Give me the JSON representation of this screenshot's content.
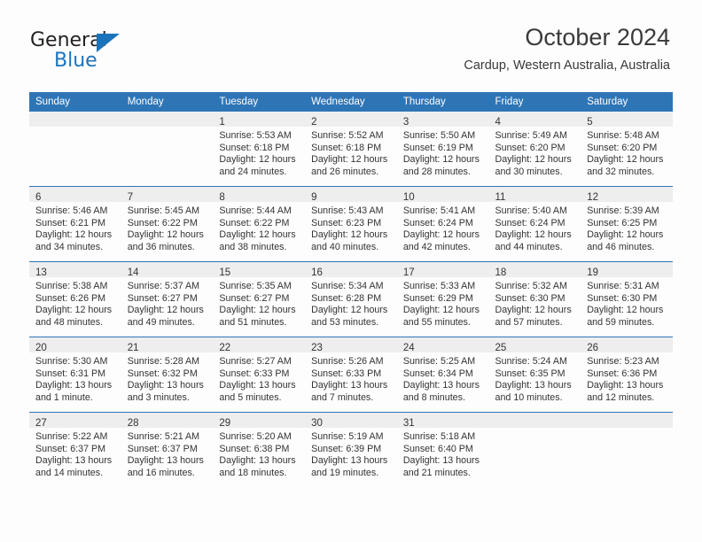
{
  "brand": {
    "name_top": "General",
    "name_bottom": "Blue",
    "accent_color": "#1b74bb"
  },
  "header": {
    "title": "October 2024",
    "subtitle": "Cardup, Western Australia, Australia"
  },
  "theme": {
    "header_bar_color": "#2e75b6",
    "daynum_band_color": "#eeeeee",
    "page_background": "#fdfdfd",
    "text_color": "#333333"
  },
  "weekday_headers": [
    "Sunday",
    "Monday",
    "Tuesday",
    "Wednesday",
    "Thursday",
    "Friday",
    "Saturday"
  ],
  "weeks": [
    [
      {
        "day": "",
        "lines": []
      },
      {
        "day": "",
        "lines": []
      },
      {
        "day": "1",
        "lines": [
          "Sunrise: 5:53 AM",
          "Sunset: 6:18 PM",
          "Daylight: 12 hours",
          "and 24 minutes."
        ]
      },
      {
        "day": "2",
        "lines": [
          "Sunrise: 5:52 AM",
          "Sunset: 6:18 PM",
          "Daylight: 12 hours",
          "and 26 minutes."
        ]
      },
      {
        "day": "3",
        "lines": [
          "Sunrise: 5:50 AM",
          "Sunset: 6:19 PM",
          "Daylight: 12 hours",
          "and 28 minutes."
        ]
      },
      {
        "day": "4",
        "lines": [
          "Sunrise: 5:49 AM",
          "Sunset: 6:20 PM",
          "Daylight: 12 hours",
          "and 30 minutes."
        ]
      },
      {
        "day": "5",
        "lines": [
          "Sunrise: 5:48 AM",
          "Sunset: 6:20 PM",
          "Daylight: 12 hours",
          "and 32 minutes."
        ]
      }
    ],
    [
      {
        "day": "6",
        "lines": [
          "Sunrise: 5:46 AM",
          "Sunset: 6:21 PM",
          "Daylight: 12 hours",
          "and 34 minutes."
        ]
      },
      {
        "day": "7",
        "lines": [
          "Sunrise: 5:45 AM",
          "Sunset: 6:22 PM",
          "Daylight: 12 hours",
          "and 36 minutes."
        ]
      },
      {
        "day": "8",
        "lines": [
          "Sunrise: 5:44 AM",
          "Sunset: 6:22 PM",
          "Daylight: 12 hours",
          "and 38 minutes."
        ]
      },
      {
        "day": "9",
        "lines": [
          "Sunrise: 5:43 AM",
          "Sunset: 6:23 PM",
          "Daylight: 12 hours",
          "and 40 minutes."
        ]
      },
      {
        "day": "10",
        "lines": [
          "Sunrise: 5:41 AM",
          "Sunset: 6:24 PM",
          "Daylight: 12 hours",
          "and 42 minutes."
        ]
      },
      {
        "day": "11",
        "lines": [
          "Sunrise: 5:40 AM",
          "Sunset: 6:24 PM",
          "Daylight: 12 hours",
          "and 44 minutes."
        ]
      },
      {
        "day": "12",
        "lines": [
          "Sunrise: 5:39 AM",
          "Sunset: 6:25 PM",
          "Daylight: 12 hours",
          "and 46 minutes."
        ]
      }
    ],
    [
      {
        "day": "13",
        "lines": [
          "Sunrise: 5:38 AM",
          "Sunset: 6:26 PM",
          "Daylight: 12 hours",
          "and 48 minutes."
        ]
      },
      {
        "day": "14",
        "lines": [
          "Sunrise: 5:37 AM",
          "Sunset: 6:27 PM",
          "Daylight: 12 hours",
          "and 49 minutes."
        ]
      },
      {
        "day": "15",
        "lines": [
          "Sunrise: 5:35 AM",
          "Sunset: 6:27 PM",
          "Daylight: 12 hours",
          "and 51 minutes."
        ]
      },
      {
        "day": "16",
        "lines": [
          "Sunrise: 5:34 AM",
          "Sunset: 6:28 PM",
          "Daylight: 12 hours",
          "and 53 minutes."
        ]
      },
      {
        "day": "17",
        "lines": [
          "Sunrise: 5:33 AM",
          "Sunset: 6:29 PM",
          "Daylight: 12 hours",
          "and 55 minutes."
        ]
      },
      {
        "day": "18",
        "lines": [
          "Sunrise: 5:32 AM",
          "Sunset: 6:30 PM",
          "Daylight: 12 hours",
          "and 57 minutes."
        ]
      },
      {
        "day": "19",
        "lines": [
          "Sunrise: 5:31 AM",
          "Sunset: 6:30 PM",
          "Daylight: 12 hours",
          "and 59 minutes."
        ]
      }
    ],
    [
      {
        "day": "20",
        "lines": [
          "Sunrise: 5:30 AM",
          "Sunset: 6:31 PM",
          "Daylight: 13 hours",
          "and 1 minute."
        ]
      },
      {
        "day": "21",
        "lines": [
          "Sunrise: 5:28 AM",
          "Sunset: 6:32 PM",
          "Daylight: 13 hours",
          "and 3 minutes."
        ]
      },
      {
        "day": "22",
        "lines": [
          "Sunrise: 5:27 AM",
          "Sunset: 6:33 PM",
          "Daylight: 13 hours",
          "and 5 minutes."
        ]
      },
      {
        "day": "23",
        "lines": [
          "Sunrise: 5:26 AM",
          "Sunset: 6:33 PM",
          "Daylight: 13 hours",
          "and 7 minutes."
        ]
      },
      {
        "day": "24",
        "lines": [
          "Sunrise: 5:25 AM",
          "Sunset: 6:34 PM",
          "Daylight: 13 hours",
          "and 8 minutes."
        ]
      },
      {
        "day": "25",
        "lines": [
          "Sunrise: 5:24 AM",
          "Sunset: 6:35 PM",
          "Daylight: 13 hours",
          "and 10 minutes."
        ]
      },
      {
        "day": "26",
        "lines": [
          "Sunrise: 5:23 AM",
          "Sunset: 6:36 PM",
          "Daylight: 13 hours",
          "and 12 minutes."
        ]
      }
    ],
    [
      {
        "day": "27",
        "lines": [
          "Sunrise: 5:22 AM",
          "Sunset: 6:37 PM",
          "Daylight: 13 hours",
          "and 14 minutes."
        ]
      },
      {
        "day": "28",
        "lines": [
          "Sunrise: 5:21 AM",
          "Sunset: 6:37 PM",
          "Daylight: 13 hours",
          "and 16 minutes."
        ]
      },
      {
        "day": "29",
        "lines": [
          "Sunrise: 5:20 AM",
          "Sunset: 6:38 PM",
          "Daylight: 13 hours",
          "and 18 minutes."
        ]
      },
      {
        "day": "30",
        "lines": [
          "Sunrise: 5:19 AM",
          "Sunset: 6:39 PM",
          "Daylight: 13 hours",
          "and 19 minutes."
        ]
      },
      {
        "day": "31",
        "lines": [
          "Sunrise: 5:18 AM",
          "Sunset: 6:40 PM",
          "Daylight: 13 hours",
          "and 21 minutes."
        ]
      },
      {
        "day": "",
        "lines": []
      },
      {
        "day": "",
        "lines": []
      }
    ]
  ]
}
